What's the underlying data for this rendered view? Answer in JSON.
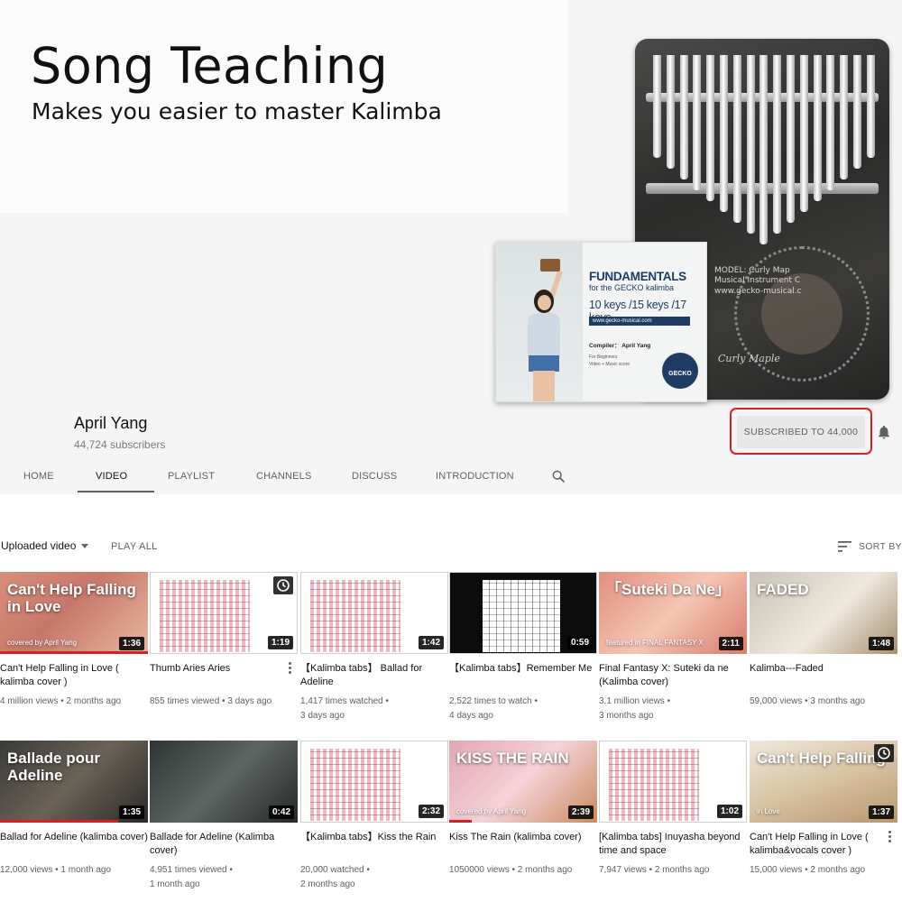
{
  "banner": {
    "title": "Song Teaching",
    "subtitle": "Makes you easier to master Kalimba",
    "book": {
      "title": "FUNDAMENTALS",
      "subtitle": "for the GECKO kalimba",
      "keys": "10 keys /15 keys /17 keys",
      "url": "www.gecko-musical.com",
      "compiler": "Compiler： April Yang",
      "small_line1": "For Beginners",
      "small_line2": "Video + Music score",
      "logo": "GECKO"
    },
    "kalimba": {
      "model_line1": "MODEL: Curly Map",
      "model_line2": "Musical Instrument C",
      "model_line3": "www.gecko-musical.c",
      "brand": "Curly Maple"
    }
  },
  "channel": {
    "name": "April Yang",
    "subscribers": "44,724 subscribers",
    "subscribe_label": "SUBSCRIBED TO  44,000",
    "bell_icon": "bell-icon"
  },
  "tabs": [
    {
      "label": "HOME"
    },
    {
      "label": "VIDEO"
    },
    {
      "label": "PLAYLIST"
    },
    {
      "label": "CHANNELS"
    },
    {
      "label": "DISCUSS"
    },
    {
      "label": "INTRODUCTION"
    }
  ],
  "toolbar": {
    "uploaded": "Uploaded video",
    "play_all": "PLAY ALL",
    "sort_by": "SORT BY"
  },
  "videos": [
    {
      "title": "Can't Help Falling in Love ( kalimba cover )",
      "meta1": "4 million views  •  2 months ago",
      "meta2": "",
      "duration": "1:36",
      "thumb_text": "Can't Help Falling in Love",
      "thumb_sub": "covered by April Yang",
      "progress": 1.0
    },
    {
      "title": "Thumb Aries Aries",
      "meta1": "855 times viewed  •  3 days ago",
      "meta2": "",
      "duration": "1:19",
      "thumb_text": "",
      "thumb_sub": "",
      "progress": 0
    },
    {
      "title": "【Kalimba tabs】 Ballad for Adeline",
      "meta1": "1,417 times watched  •",
      "meta2": "3 days ago",
      "duration": "1:42",
      "thumb_text": "",
      "thumb_sub": "",
      "progress": 0
    },
    {
      "title": "【Kalimba tabs】Remember Me",
      "meta1": "2,522 times to watch  •",
      "meta2": "4 days ago",
      "duration": "0:59",
      "thumb_text": "",
      "thumb_sub": "",
      "progress": 0
    },
    {
      "title": "Final Fantasy X: Suteki da ne (Kalimba cover)",
      "meta1": "3.1 million views  •",
      "meta2": "3 months ago",
      "duration": "2:11",
      "thumb_text": "「Suteki Da Ne」",
      "thumb_sub": "featured in FINAL FANTASY X",
      "progress": 0
    },
    {
      "title": "Kalimba---Faded",
      "meta1": "59,000 views  •  3 months ago",
      "meta2": "",
      "duration": "1:48",
      "thumb_text": "FADED",
      "thumb_sub": "",
      "progress": 0
    },
    {
      "title": "Ballad for Adeline (kalimba cover)",
      "meta1": "12,000 views  •  1 month ago",
      "meta2": "",
      "duration": "1:35",
      "thumb_text": "Ballade pour Adeline",
      "thumb_sub": "",
      "progress": 0.8
    },
    {
      "title": "Ballade for Adeline (Kalimba cover)",
      "meta1": "4,951 times viewed  •",
      "meta2": "1 month ago",
      "duration": "0:42",
      "thumb_text": "",
      "thumb_sub": "",
      "progress": 0
    },
    {
      "title": "【Kalimba tabs】Kiss the Rain",
      "meta1": "20,000 watched  •",
      "meta2": "2 months ago",
      "duration": "2:32",
      "thumb_text": "",
      "thumb_sub": "",
      "progress": 0
    },
    {
      "title": "Kiss The Rain (kalimba cover)",
      "meta1": "1050000 views  •  2 months ago",
      "meta2": "",
      "duration": "2:39",
      "thumb_text": "KISS THE RAIN",
      "thumb_sub": "covered by April Yang",
      "progress": 0.15
    },
    {
      "title": "[Kalimba tabs] Inuyasha beyond time and space",
      "meta1": "7,947 views  •  2 months ago",
      "meta2": "",
      "duration": "1:02",
      "thumb_text": "",
      "thumb_sub": "",
      "progress": 0
    },
    {
      "title": "Can't Help Falling in Love ( kalimba&vocals cover )",
      "meta1": "15,000 views  •  2 months ago",
      "meta2": "",
      "duration": "1:37",
      "thumb_text": "Can't Help Falling",
      "thumb_sub": "in Love",
      "progress": 0
    }
  ]
}
